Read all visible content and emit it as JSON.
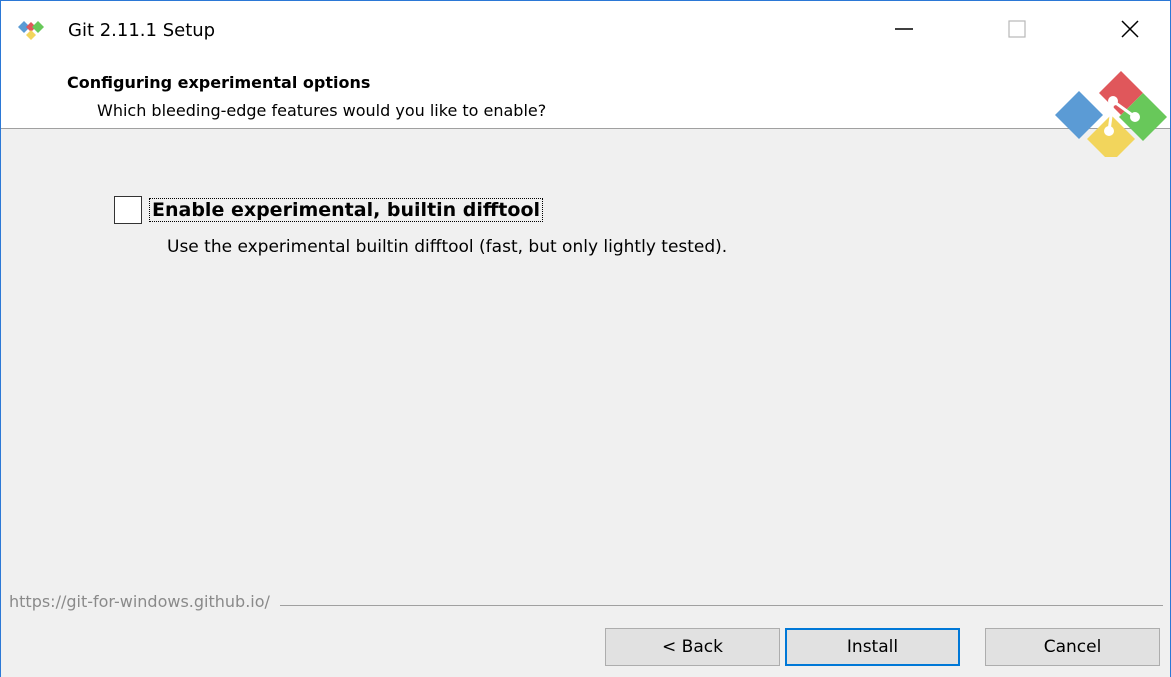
{
  "window": {
    "title": "Git 2.11.1 Setup"
  },
  "header": {
    "title": "Configuring experimental options",
    "subtitle": "Which bleeding-edge features would you like to enable?"
  },
  "option": {
    "label": "Enable experimental, builtin difftool",
    "description": "Use the experimental builtin difftool (fast, but only lightly tested).",
    "checked": false
  },
  "footer": {
    "link": "https://git-for-windows.github.io/"
  },
  "buttons": {
    "back": "< Back",
    "install": "Install",
    "cancel": "Cancel"
  },
  "colors": {
    "accent": "#0078d7",
    "logo_red": "#e0575b",
    "logo_blue": "#5b9bd5",
    "logo_green": "#68c85a",
    "logo_yellow": "#f2d55c"
  }
}
